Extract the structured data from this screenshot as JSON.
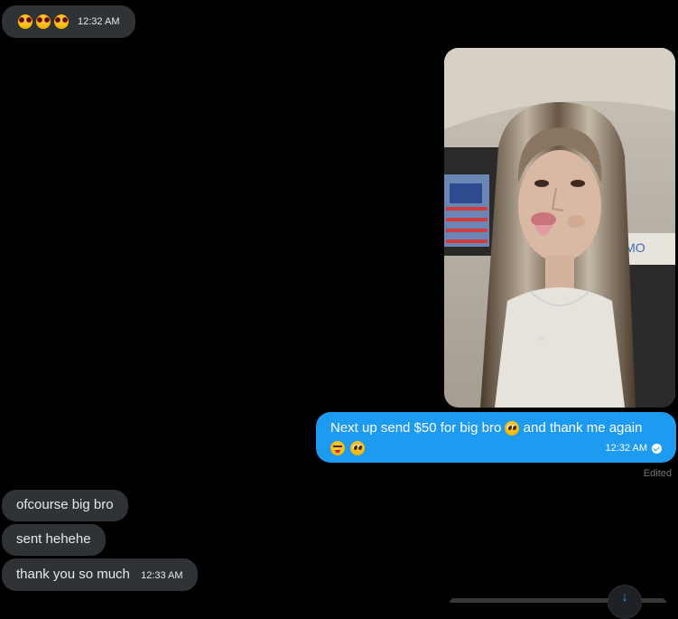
{
  "messages": {
    "m1": {
      "emojis": [
        "nerd-face",
        "nerd-face",
        "nerd-face"
      ],
      "time": "12:32 AM"
    },
    "m2": {
      "type": "image",
      "image_desc_icon": "photo-icon"
    },
    "m3": {
      "text_part1": "Next up send $50 for big bro",
      "text_part2": " and thank me again",
      "emojis_inline": [
        "pleading-face"
      ],
      "emojis_line2": [
        "winking-tongue-face",
        "pleading-face"
      ],
      "time": "12:32 AM",
      "status_icon": "check-circle-icon",
      "edited": "Edited"
    },
    "m4": {
      "text": "ofcourse big bro"
    },
    "m5": {
      "text": "sent hehehe"
    },
    "m6": {
      "text": "thank you so much",
      "time": "12:33 AM"
    }
  },
  "scroll_button": {
    "icon": "arrow-down-icon"
  },
  "colors": {
    "sent_bubble": "#1d9bf0",
    "received_bubble": "#2f3336",
    "background": "#000000"
  }
}
